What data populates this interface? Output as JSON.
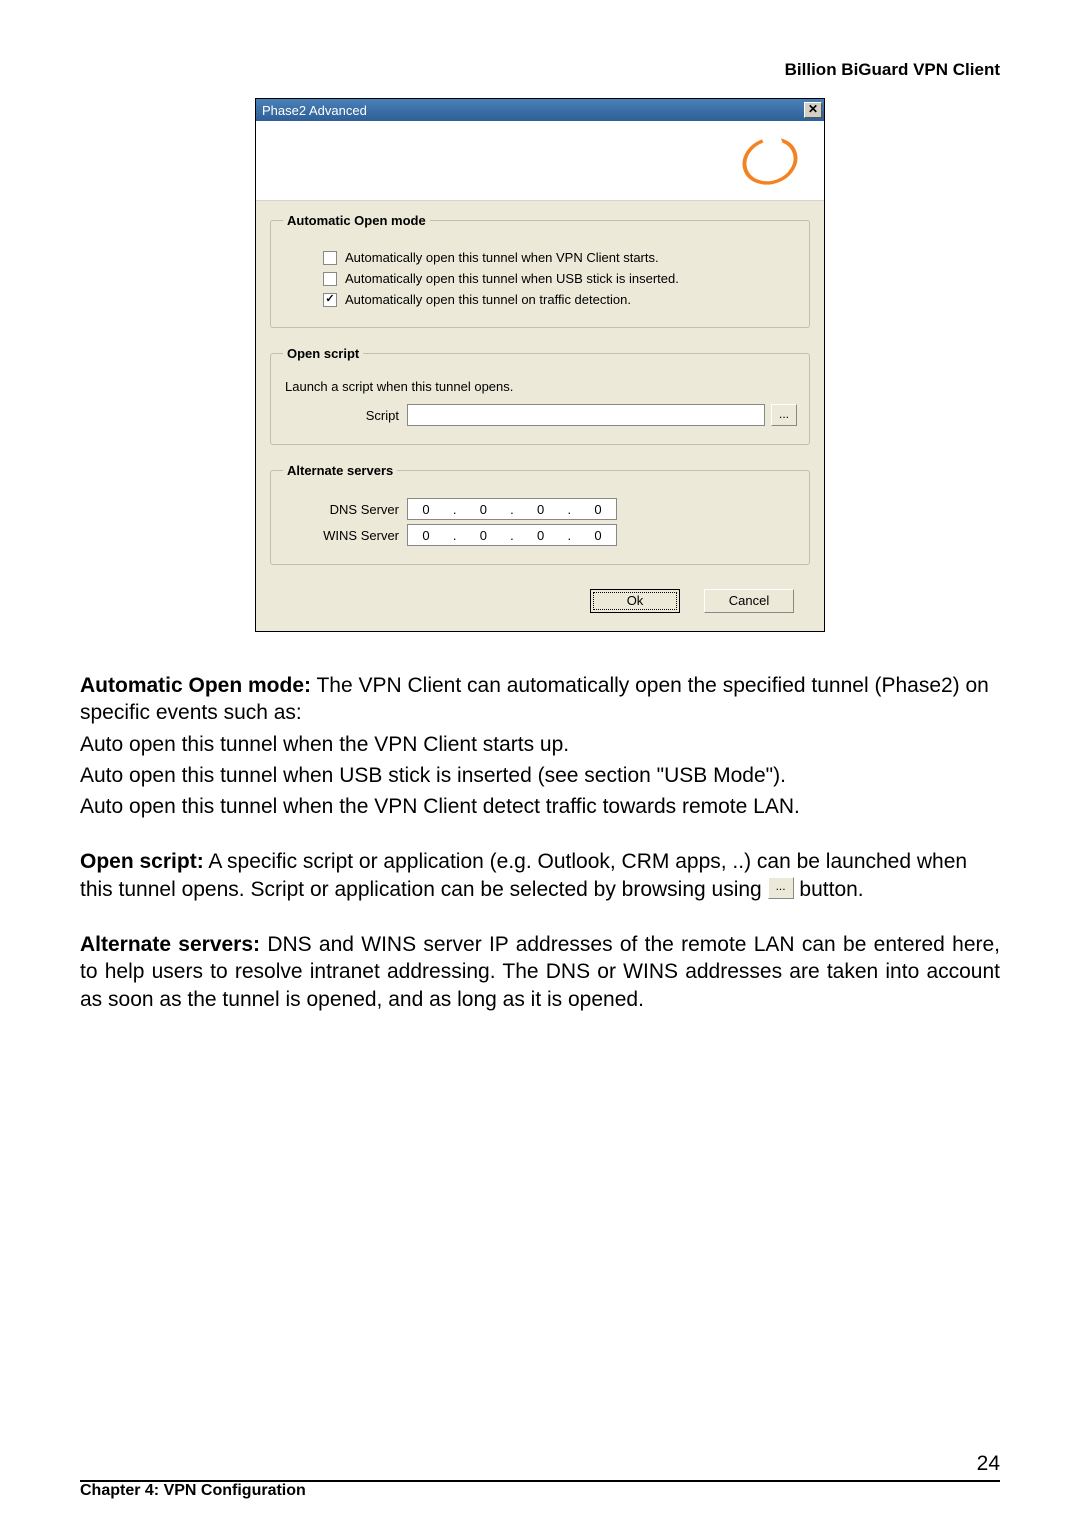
{
  "header": {
    "product": "Billion BiGuard VPN Client"
  },
  "dialog": {
    "title": "Phase2 Advanced",
    "close_glyph": "✕",
    "automatic_open": {
      "legend": "Automatic Open mode",
      "opt1": {
        "checked": false,
        "label": "Automatically open this tunnel when VPN Client starts."
      },
      "opt2": {
        "checked": false,
        "label": "Automatically open this tunnel when USB stick is inserted."
      },
      "opt3": {
        "checked": true,
        "label": "Automatically open this tunnel on traffic detection."
      }
    },
    "open_script": {
      "legend": "Open script",
      "description": "Launch a script when this tunnel opens.",
      "field_label": "Script",
      "value": "",
      "browse_glyph": "..."
    },
    "alternate_servers": {
      "legend": "Alternate servers",
      "dns_label": "DNS Server",
      "wins_label": "WINS Server",
      "dns": [
        "0",
        "0",
        "0",
        "0"
      ],
      "wins": [
        "0",
        "0",
        "0",
        "0"
      ],
      "dot": "."
    },
    "buttons": {
      "ok": "Ok",
      "cancel": "Cancel"
    }
  },
  "doc": {
    "auto_open_heading": "Automatic Open mode:",
    "auto_open_body": " The VPN Client can automatically open the specified tunnel (Phase2) on specific events such as:",
    "auto_open_l1": "Auto open this tunnel when the VPN Client starts up.",
    "auto_open_l2": "Auto open this tunnel when USB stick is inserted (see section \"USB Mode\").",
    "auto_open_l3": "Auto open this tunnel when the VPN Client detect traffic towards remote LAN.",
    "open_script_heading": "Open script:",
    "open_script_body_a": " A specific script or application (e.g. Outlook, CRM apps, ..) can be launched when this tunnel opens. Script or application can be selected by browsing using ",
    "open_script_body_b": " button.",
    "inline_browse_glyph": "...",
    "alt_servers_heading": "Alternate servers:",
    "alt_servers_body": " DNS and WINS server IP addresses of the remote LAN can be entered here, to help users to resolve intranet addressing. The DNS or WINS addresses are taken into account as soon as the tunnel is opened, and as long as it is opened."
  },
  "footer": {
    "chapter": "Chapter 4: VPN Configuration",
    "page": "24"
  }
}
